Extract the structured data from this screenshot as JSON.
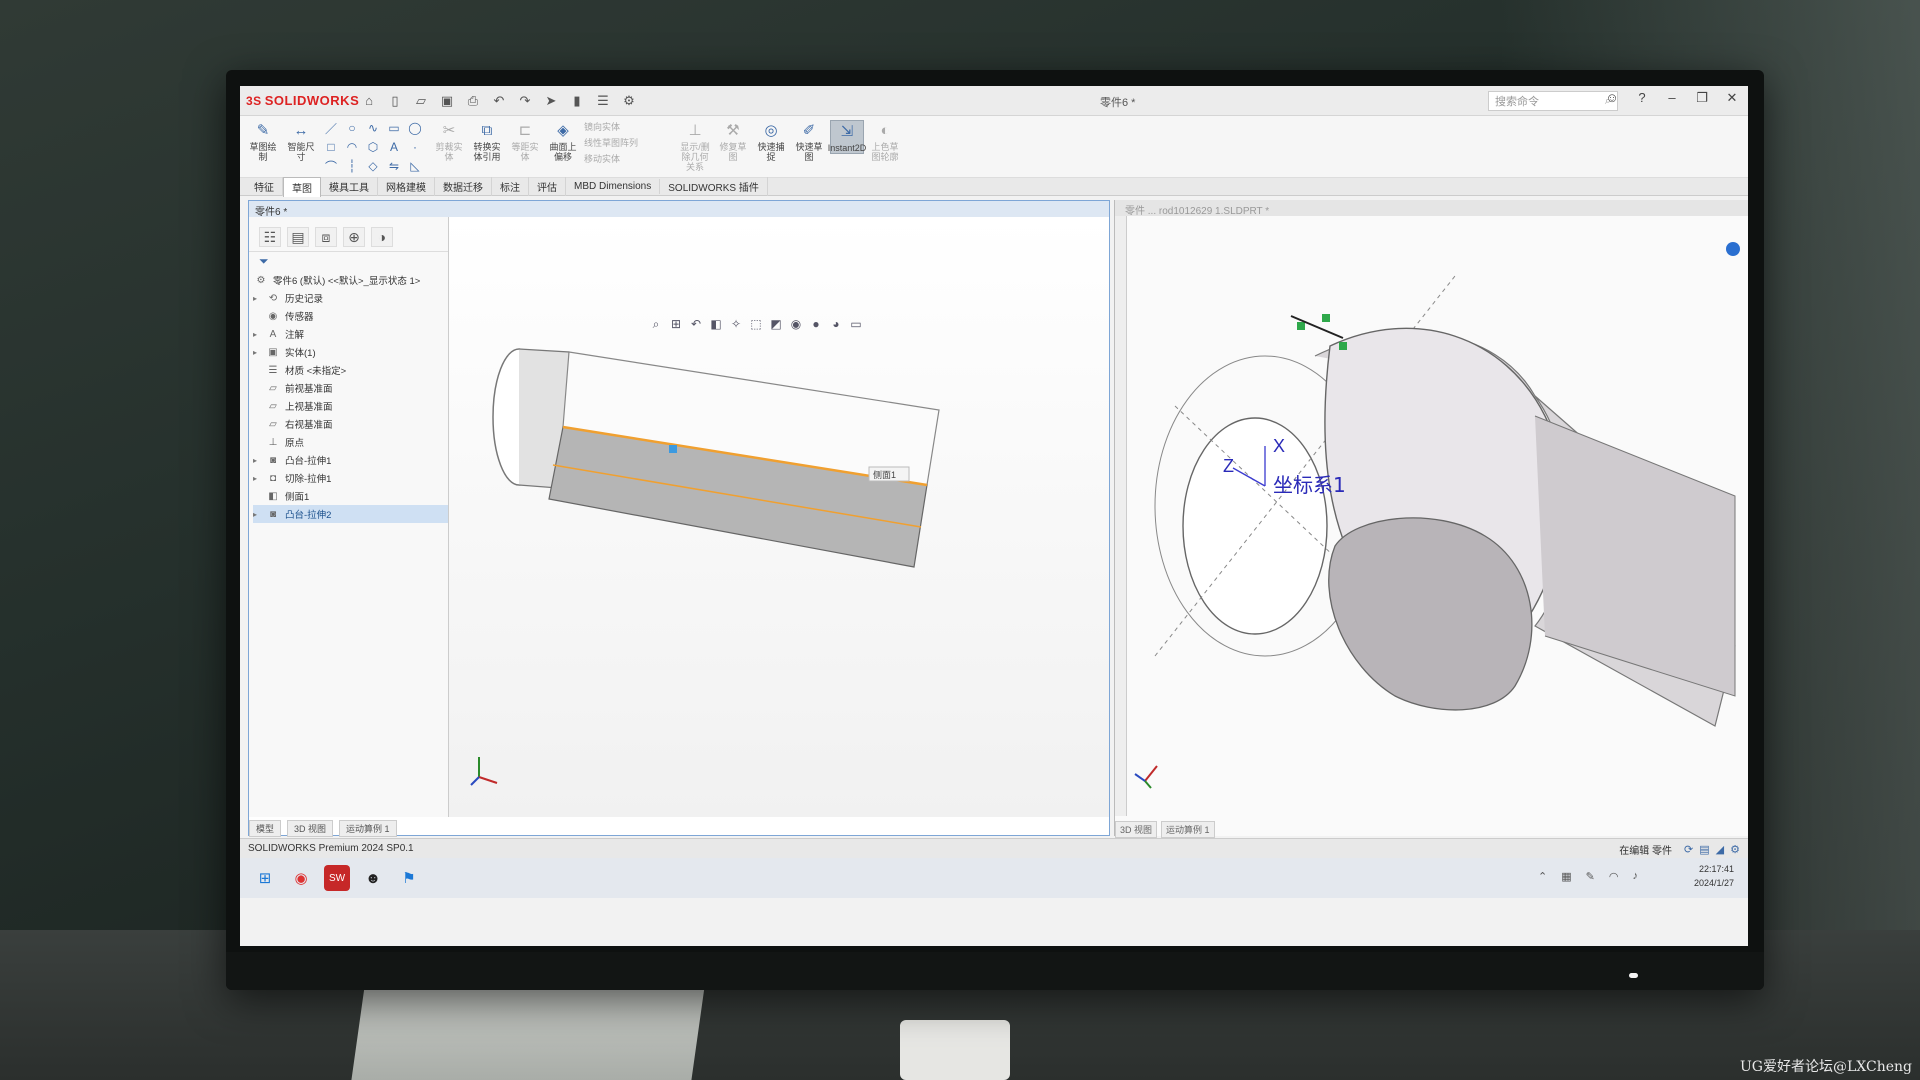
{
  "app": {
    "brand": "SOLIDWORKS",
    "brand_prefix": "3S",
    "doc_title": "零件6 *",
    "search_placeholder": "搜索命令",
    "accent": "#3d6aa6",
    "brand_color": "#dd2222"
  },
  "ribbon": {
    "buttons": [
      {
        "label": "草图绘制",
        "icon": "sketch-icon",
        "state": "normal"
      },
      {
        "label": "智能尺寸",
        "icon": "dimension-icon",
        "state": "normal"
      },
      {
        "label": "剪裁实体",
        "icon": "trim-icon",
        "state": "disabled"
      },
      {
        "label": "转换实体引用",
        "icon": "convert-icon",
        "state": "normal"
      },
      {
        "label": "等距实体",
        "icon": "offset-icon",
        "state": "disabled"
      },
      {
        "label": "曲面上偏移",
        "icon": "surface-offset-icon",
        "state": "normal"
      },
      {
        "label": "显示/删除几何关系",
        "icon": "relations-icon",
        "state": "disabled"
      },
      {
        "label": "修复草图",
        "icon": "repair-icon",
        "state": "disabled"
      },
      {
        "label": "快速捕捉",
        "icon": "snap-icon",
        "state": "normal"
      },
      {
        "label": "快速草图",
        "icon": "rapid-sketch-icon",
        "state": "normal"
      },
      {
        "label": "Instant2D",
        "icon": "instant2d-icon",
        "state": "active"
      },
      {
        "label": "上色草图轮廓",
        "icon": "shaded-sketch-icon",
        "state": "disabled"
      }
    ],
    "mini_list": [
      "镜向实体",
      "线性草图阵列",
      "移动实体"
    ]
  },
  "tabs": [
    "特征",
    "草图",
    "模具工具",
    "网格建模",
    "数据迁移",
    "标注",
    "评估",
    "MBD Dimensions",
    "SOLIDWORKS 插件"
  ],
  "left_doc": {
    "title": "零件6 *",
    "tree_root": "零件6 (默认) <<默认>_显示状态 1>",
    "tree": [
      {
        "label": "历史记录",
        "icon": "history-icon",
        "expandable": true
      },
      {
        "label": "传感器",
        "icon": "sensor-icon",
        "expandable": false
      },
      {
        "label": "注解",
        "icon": "annotation-icon",
        "expandable": true
      },
      {
        "label": "实体(1)",
        "icon": "solid-body-icon",
        "expandable": true
      },
      {
        "label": "材质 <未指定>",
        "icon": "material-icon",
        "expandable": false
      },
      {
        "label": "前视基准面",
        "icon": "plane-icon",
        "expandable": false
      },
      {
        "label": "上视基准面",
        "icon": "plane-icon",
        "expandable": false
      },
      {
        "label": "右视基准面",
        "icon": "plane-icon",
        "expandable": false
      },
      {
        "label": "原点",
        "icon": "origin-icon",
        "expandable": false
      },
      {
        "label": "凸台-拉伸1",
        "icon": "extrude-icon",
        "expandable": true
      },
      {
        "label": "切除-拉伸1",
        "icon": "cut-icon",
        "expandable": true
      },
      {
        "label": "侧面1",
        "icon": "face-icon",
        "expandable": false
      },
      {
        "label": "凸台-拉伸2",
        "icon": "extrude-icon",
        "expandable": true,
        "selected": true
      }
    ],
    "bottom_tabs": [
      "模型",
      "3D 视图",
      "运动算例 1"
    ],
    "face_label": "侧面1"
  },
  "right_doc": {
    "title": "零件 ... rod1012629 1.SLDPRT *",
    "coord_label": "坐标系1",
    "axis_x": "X",
    "axis_z": "Z",
    "bottom_tabs": [
      "3D 视图",
      "运动算例 1"
    ]
  },
  "status": {
    "left": "SOLIDWORKS Premium 2024 SP0.1",
    "right": "在编辑 零件"
  },
  "taskbar": {
    "time": "22:17:41",
    "date": "2024/1/27"
  },
  "watermark": "UG爱好者论坛@LXCheng"
}
